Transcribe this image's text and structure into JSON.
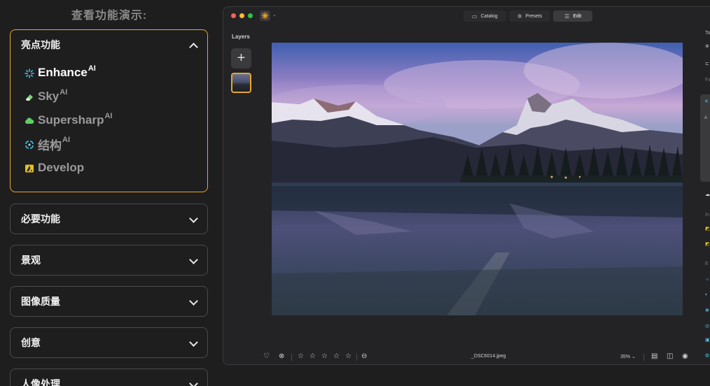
{
  "left_panel": {
    "title": "查看功能演示:",
    "sections": [
      {
        "label": "亮点功能",
        "open": true
      },
      {
        "label": "必要功能",
        "open": false
      },
      {
        "label": "景观",
        "open": false
      },
      {
        "label": "图像质量",
        "open": false
      },
      {
        "label": "创意",
        "open": false
      },
      {
        "label": "人像处理",
        "open": false
      }
    ],
    "features": [
      {
        "name": "Enhance",
        "sup": "AI",
        "icon": "enhance-sparkle-icon",
        "color": "#4ec3e6",
        "active": true
      },
      {
        "name": "Sky",
        "sup": "AI",
        "icon": "sky-eraser-icon",
        "color": "#7ed67a",
        "active": false
      },
      {
        "name": "Supersharp",
        "sup": "AI",
        "icon": "cloud-icon",
        "color": "#5fcf63",
        "active": false
      },
      {
        "name": "结构",
        "sup": "AI",
        "icon": "structure-icon",
        "color": "#41b8d8",
        "active": false
      },
      {
        "name": "Develop",
        "sup": "",
        "icon": "develop-icon",
        "color": "#e6c02a",
        "active": false
      }
    ],
    "accent": "#e6a82a"
  },
  "app": {
    "tabs": [
      {
        "label": "Catalog",
        "icon": "folder-icon",
        "active": false
      },
      {
        "label": "Presets",
        "icon": "presets-icon",
        "active": false
      },
      {
        "label": "Edit",
        "icon": "sliders-icon",
        "active": true
      }
    ],
    "layers_label": "Layers",
    "add_label": "+",
    "filename": "_DSC6014.jpeg",
    "zoom": "35%",
    "traffic_lights": [
      "#ff5f57",
      "#febc2e",
      "#28c840"
    ],
    "right_edge_text": [
      "To",
      "Fa",
      "A",
      "In",
      "E"
    ]
  }
}
